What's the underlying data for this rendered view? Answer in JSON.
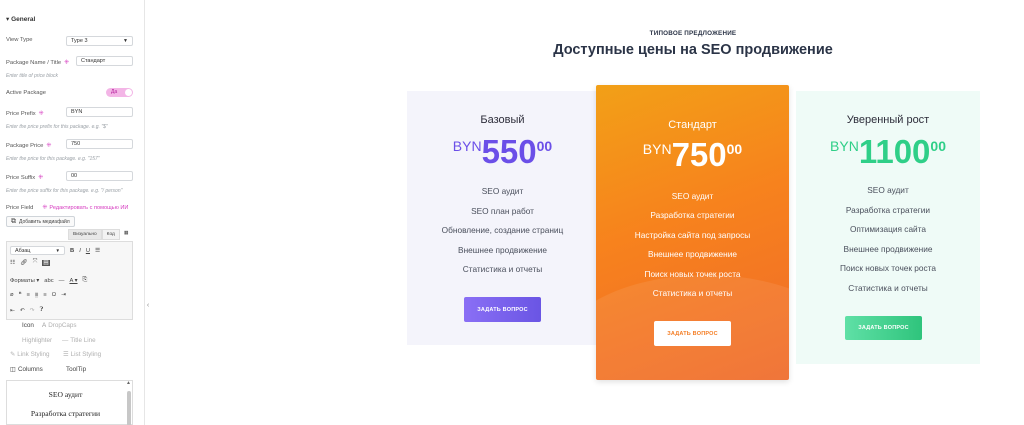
{
  "panel": {
    "section_title": "General",
    "view_type": {
      "label": "View Type",
      "value": "Type 3"
    },
    "package_name": {
      "label": "Package Name / Title",
      "value": "Стандарт",
      "hint": "Enter title of price block"
    },
    "active_package": {
      "label": "Active Package",
      "value": "Да"
    },
    "price_prefix": {
      "label": "Price Prefix",
      "value": "BYN",
      "hint": "Enter the price prefix for this package. e.g. \"$\""
    },
    "package_price": {
      "label": "Package Price",
      "value": "750",
      "hint": "Enter the price for this package. e.g. \"157\""
    },
    "price_suffix": {
      "label": "Price Suffix",
      "value": "00",
      "hint": "Enter the price suffix for this package. e.g. \"/ person\""
    },
    "price_field": {
      "label": "Price Field",
      "ai_link": "Редактировать с помощью ИИ"
    },
    "media_button": "Добавить медиафайл",
    "tabs": [
      "Визуально",
      "Код"
    ],
    "toolbar": {
      "paragraph": "Абзац",
      "formats": "Форматы"
    },
    "extensions": {
      "icon": "Icon",
      "dropcaps": "DropCaps",
      "highlighter": "Highlighter",
      "title_line": "Title Line",
      "link_styling": "Link Styling",
      "list_styling": "List Styling",
      "columns": "Columns",
      "tooltip": "ToolTip"
    },
    "editor_lines": [
      "SEO аудит",
      "Разработка стратегии"
    ]
  },
  "preview": {
    "eyebrow": "ТИПОВОЕ ПРЕДЛОЖЕНИЕ",
    "heading": "Доступные цены на SEO продвижение",
    "cards": [
      {
        "title": "Базовый",
        "prefix": "BYN",
        "price": "550",
        "suffix": "00",
        "features": [
          "SEO аудит",
          "SEO план работ",
          "Обновление, создание страниц",
          "Внешнее продвижение",
          "Статистика и отчеты"
        ],
        "button": "ЗАДАТЬ ВОПРОС"
      },
      {
        "title": "Стандарт",
        "prefix": "BYN",
        "price": "750",
        "suffix": "00",
        "features": [
          "SEO аудит",
          "Разработка стратегии",
          "Настройка сайта под запросы",
          "Внешнее продвижение",
          "Поиск новых точек роста",
          "Статистика и отчеты"
        ],
        "button": "ЗАДАТЬ ВОПРОС"
      },
      {
        "title": "Уверенный рост",
        "prefix": "BYN",
        "price": "1100",
        "suffix": "00",
        "features": [
          "SEO аудит",
          "Разработка стратегии",
          "Оптимизация сайта",
          "Внешнее продвижение",
          "Поиск новых точек роста",
          "Статистика и отчеты"
        ],
        "button": "ЗАДАТЬ ВОПРОС"
      }
    ]
  },
  "colors": {
    "accent_purple": "#6b4fe8",
    "accent_orange": "#f7821d",
    "accent_green": "#2fcf88",
    "dynamic_pink": "#d63cc0"
  }
}
